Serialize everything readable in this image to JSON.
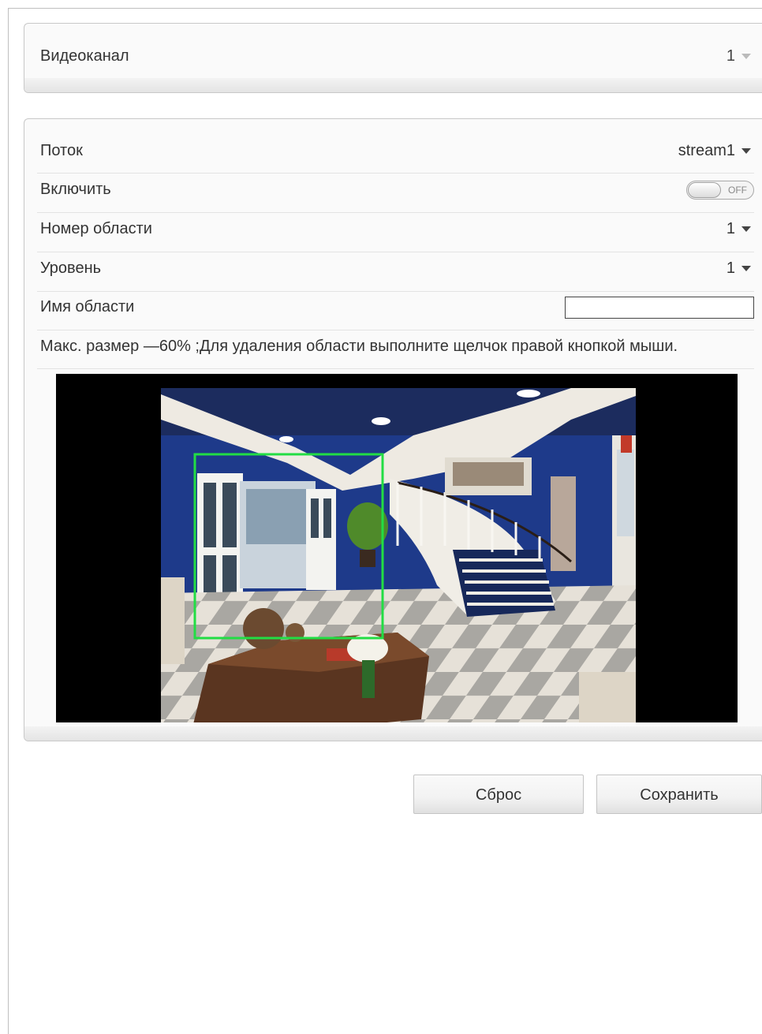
{
  "channel": {
    "label": "Видеоканал",
    "value": "1"
  },
  "settings": {
    "stream": {
      "label": "Поток",
      "value": "stream1"
    },
    "enable": {
      "label": "Включить",
      "state": "OFF"
    },
    "area_number": {
      "label": "Номер области",
      "value": "1"
    },
    "level": {
      "label": "Уровень",
      "value": "1"
    },
    "area_name": {
      "label": "Имя области",
      "value": ""
    },
    "hint": "Макс. размер —60% ;Для удаления области выполните щелчок правой кнопкой мыши."
  },
  "buttons": {
    "reset": "Сброс",
    "save": "Сохранить"
  },
  "colors": {
    "region_outline": "#22dd44",
    "ceiling": "#1c2c5e",
    "wall": "#1e3a8a"
  }
}
